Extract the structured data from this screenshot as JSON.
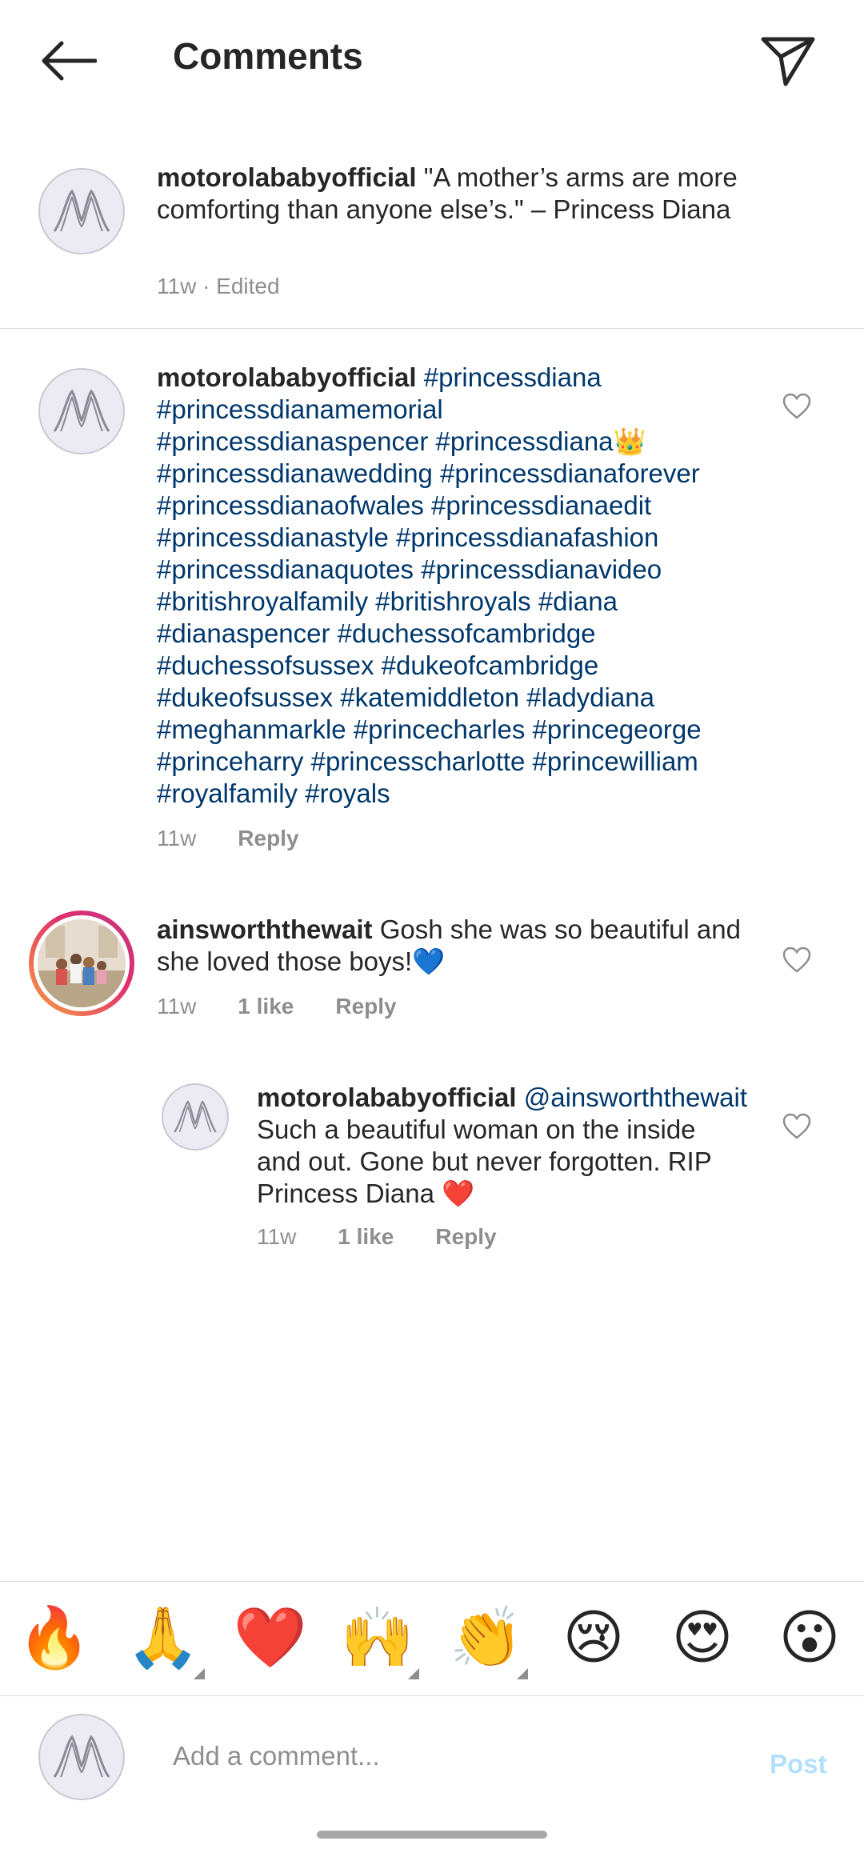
{
  "header": {
    "title": "Comments",
    "back_icon": "arrow-left-icon",
    "send_icon": "paper-plane-icon"
  },
  "caption": {
    "username": "motorolababyofficial",
    "text": "\"A mother’s arms are more comforting than anyone else’s.\" – Princess Diana",
    "meta": "11w · Edited"
  },
  "comments": [
    {
      "username": "motorolababyofficial",
      "lines": [
        "#princessdiana",
        "#princessdianamemorial",
        "#princessdianaspencer #princessdiana👑",
        "#princessdianawedding #princessdianaforever",
        "#princessdianaofwales #princessdianaedit",
        "#princessdianastyle #princessdianafashion",
        "#princessdianaquotes #princessdianavideo",
        "#britishroyalfamily #britishroyals #diana",
        "#dianaspencer #duchessofcambridge",
        "#duchessofsussex #dukeofcambridge",
        "#dukeofsussex #katemiddleton #ladydiana",
        "#meghanmarkle #princecharles #princegeorge",
        "#princeharry #princesscharlotte #princewilliam",
        "#royalfamily #royals"
      ],
      "time": "11w",
      "reply": "Reply"
    },
    {
      "username": "ainsworththewait",
      "text_line1": "Gosh she was so beautiful and",
      "text_line2": "she loved those boys!💙",
      "time": "11w",
      "likes": "1 like",
      "reply": "Reply"
    },
    {
      "username": "motorolababyofficial",
      "mention": "@ainsworththewait",
      "text_line1": "Such a beautiful woman on the inside",
      "text_line2": "and out. Gone but never forgotten. RIP",
      "text_line3": "Princess Diana ❤️",
      "time": "11w",
      "likes": "1 like",
      "reply": "Reply"
    }
  ],
  "emoji_bar": [
    "🔥",
    "🙏",
    "❤️",
    "🙌",
    "👏",
    "😢",
    "😍",
    "😮"
  ],
  "composer": {
    "placeholder": "Add a comment...",
    "post_label": "Post"
  },
  "colors": {
    "hashtag": "#00376b",
    "meta": "#8e8e8e",
    "post_disabled": "#b2dffc"
  }
}
